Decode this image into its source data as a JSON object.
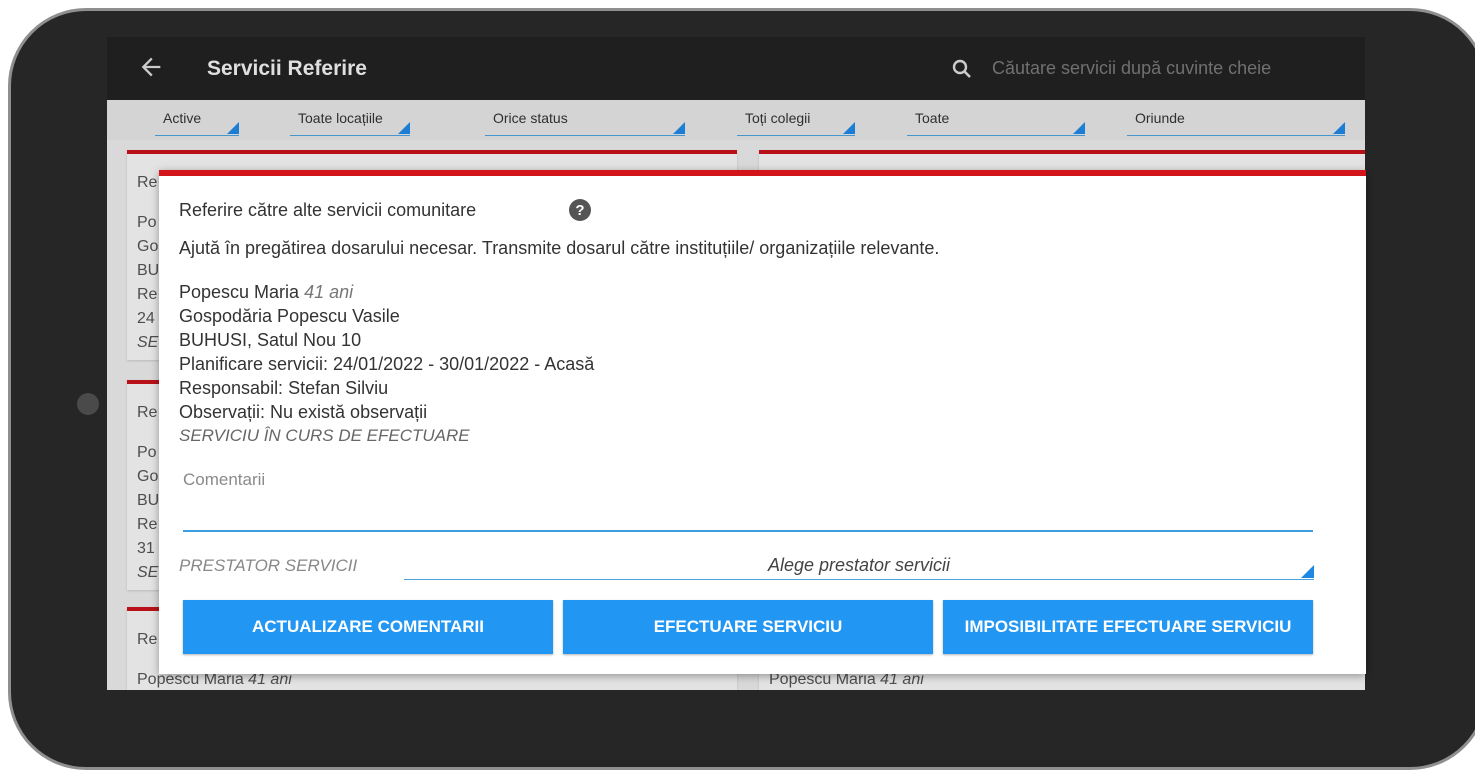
{
  "appbar": {
    "title": "Servicii Referire",
    "search_placeholder": "Căutare servicii după cuvinte cheie",
    "back_icon": "back-arrow-icon",
    "search_icon": "search-icon"
  },
  "filters": [
    {
      "label": "Active"
    },
    {
      "label": "Toate locațiile"
    },
    {
      "label": "Orice status"
    },
    {
      "label": "Toți colegii"
    },
    {
      "label": "Toate"
    },
    {
      "label": "Oriunde"
    }
  ],
  "background_cards": {
    "left_fragments": [
      "Re",
      "Po",
      "Go",
      "BU",
      "Re",
      "24",
      "SE",
      "Re",
      "Po",
      "Go",
      "BU",
      "Re",
      "31",
      "SE",
      "Re"
    ],
    "bottom_left_name": "Popescu Maria",
    "bottom_left_age": "41 ani",
    "bottom_right_name": "Popescu Maria",
    "bottom_right_age": "41 ani"
  },
  "dialog": {
    "title": "Referire către alte servicii comunitare",
    "help_icon": "help-icon",
    "description": "Ajută în pregătirea dosarului necesar. Transmite dosarul către instituțiile/ organizațiile relevante.",
    "person_name": "Popescu Maria",
    "person_age": "41 ani",
    "household": "Gospodăria Popescu Vasile",
    "address": "BUHUSI, Satul Nou 10",
    "planning": "Planificare servicii:  24/01/2022 - 30/01/2022   -   Acasă",
    "responsible": "Responsabil:  Stefan Silviu",
    "observations": "Observații:  Nu există observații",
    "status": "SERVICIU ÎN CURS DE EFECTUARE",
    "comments_placeholder": "Comentarii",
    "provider_label": "PRESTATOR SERVICII",
    "provider_value": "Alege prestator servicii",
    "buttons": {
      "update": "ACTUALIZARE COMENTARII",
      "perform": "EFECTUARE SERVICIU",
      "impossible": "IMPOSIBILITATE EFECTUARE SERVICIU"
    }
  },
  "colors": {
    "accent_red": "#d4141b",
    "button_blue": "#2196f3",
    "appbar_dark": "#222222"
  }
}
